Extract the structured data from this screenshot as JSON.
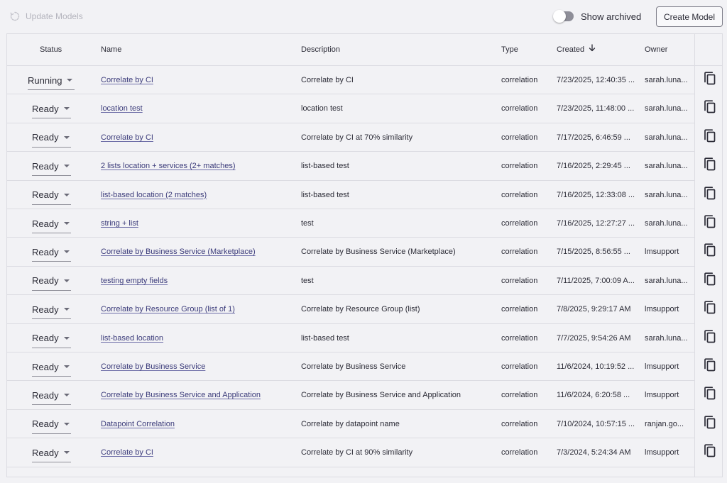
{
  "toolbar": {
    "update_models_label": "Update Models",
    "show_archived_label": "Show archived",
    "create_model_label": "Create Model"
  },
  "table": {
    "headers": {
      "status": "Status",
      "name": "Name",
      "description": "Description",
      "type": "Type",
      "created": "Created",
      "owner": "Owner"
    },
    "sort": {
      "column": "created",
      "direction": "descending"
    },
    "rows": [
      {
        "status": "Running",
        "name": "Correlate by CI",
        "description": "Correlate by CI",
        "type": "correlation",
        "created": "7/23/2025, 12:40:35 ...",
        "owner": "sarah.luna..."
      },
      {
        "status": "Ready",
        "name": "location test",
        "description": "location test",
        "type": "correlation",
        "created": "7/23/2025, 11:48:00 ...",
        "owner": "sarah.luna..."
      },
      {
        "status": "Ready",
        "name": "Correlate by CI",
        "description": "Correlate by CI at 70% similarity",
        "type": "correlation",
        "created": "7/17/2025, 6:46:59 ...",
        "owner": "sarah.luna..."
      },
      {
        "status": "Ready",
        "name": "2 lists location + services (2+ matches)",
        "description": "list-based test",
        "type": "correlation",
        "created": "7/16/2025, 2:29:45 ...",
        "owner": "sarah.luna..."
      },
      {
        "status": "Ready",
        "name": "list-based location (2 matches)",
        "description": "list-based test",
        "type": "correlation",
        "created": "7/16/2025, 12:33:08 ...",
        "owner": "sarah.luna..."
      },
      {
        "status": "Ready",
        "name": "string + list",
        "description": "test",
        "type": "correlation",
        "created": "7/16/2025, 12:27:27 ...",
        "owner": "sarah.luna..."
      },
      {
        "status": "Ready",
        "name": "Correlate by Business Service (Marketplace)",
        "description": "Correlate by Business Service (Marketplace)",
        "type": "correlation",
        "created": "7/15/2025, 8:56:55 ...",
        "owner": "lmsupport"
      },
      {
        "status": "Ready",
        "name": "testing empty fields",
        "description": "test",
        "type": "correlation",
        "created": "7/11/2025, 7:00:09 A...",
        "owner": "sarah.luna..."
      },
      {
        "status": "Ready",
        "name": "Correlate by Resource Group (list of 1)",
        "description": "Correlate by Resource Group (list)",
        "type": "correlation",
        "created": "7/8/2025, 9:29:17 AM",
        "owner": "lmsupport"
      },
      {
        "status": "Ready",
        "name": "list-based location",
        "description": "list-based test",
        "type": "correlation",
        "created": "7/7/2025, 9:54:26 AM",
        "owner": "sarah.luna..."
      },
      {
        "status": "Ready",
        "name": "Correlate by Business Service",
        "description": "Correlate by Business Service",
        "type": "correlation",
        "created": "11/6/2024, 10:19:52 ...",
        "owner": "lmsupport"
      },
      {
        "status": "Ready",
        "name": "Correlate by Business Service and Application",
        "description": "Correlate by Business Service and Application",
        "type": "correlation",
        "created": "11/6/2024, 6:20:58 ...",
        "owner": "lmsupport"
      },
      {
        "status": "Ready",
        "name": "Datapoint Correlation",
        "description": "Correlate by datapoint name",
        "type": "correlation",
        "created": "7/10/2024, 10:57:15 ...",
        "owner": "ranjan.go..."
      },
      {
        "status": "Ready",
        "name": "Correlate by CI",
        "description": "Correlate by CI at 90% similarity",
        "type": "correlation",
        "created": "7/3/2024, 5:24:34 AM",
        "owner": "lmsupport"
      }
    ]
  },
  "icons": {
    "refresh": "refresh-icon",
    "sort": "arrow-down-icon",
    "copy": "copy-icon"
  },
  "colors": {
    "link": "#3b3b7a",
    "background": "#f2f2f5",
    "border": "#dcdce2",
    "disabled_text": "#b4b4bd"
  }
}
